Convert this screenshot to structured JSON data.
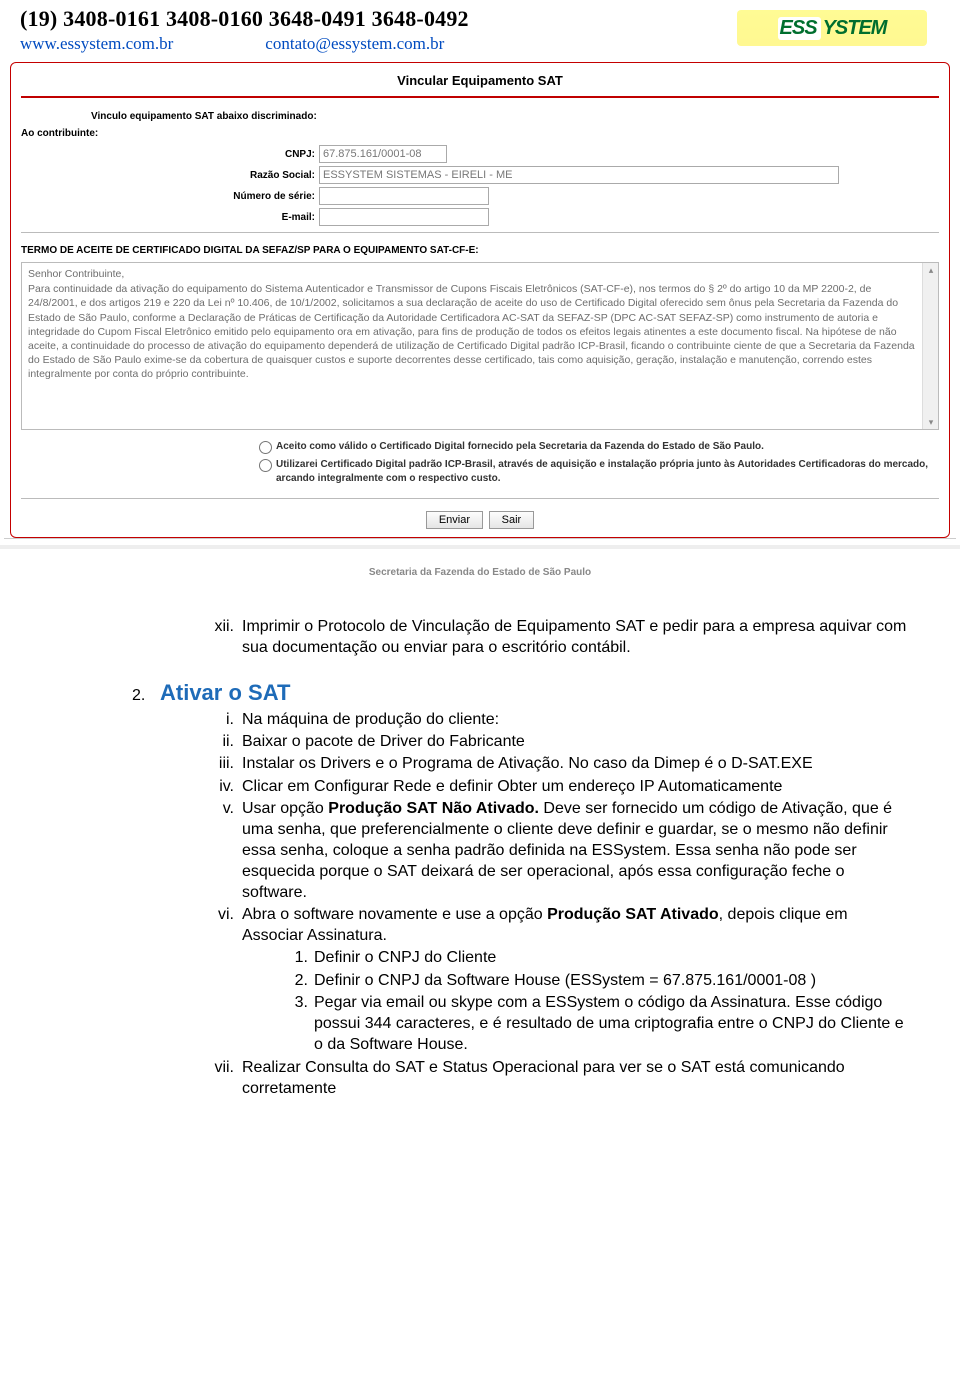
{
  "header": {
    "phones": "(19) 3408-0161   3408-0160     3648-0491     3648-0492",
    "website": "www.essystem.com.br",
    "email": "contato@essystem.com.br",
    "logo_text_1": "ESS",
    "logo_text_2": "YSTEM"
  },
  "form": {
    "title": "Vincular Equipamento SAT",
    "sub1": "Vinculo equipamento SAT abaixo discriminado:",
    "sub2": "Ao contribuinte:",
    "cnpj_label": "CNPJ:",
    "cnpj_value": "67.875.161/0001-08",
    "razao_label": "Razão Social:",
    "razao_value": "ESSYSTEM SISTEMAS - EIRELI - ME",
    "serie_label": "Número de série:",
    "serie_value": "",
    "email_label": "E-mail:",
    "email_value": "",
    "term_head": "TERMO DE ACEITE DE CERTIFICADO DIGITAL DA SEFAZ/SP PARA O EQUIPAMENTO SAT-CF-E:",
    "term_body_sal": "Senhor Contribuinte,",
    "term_body": "Para continuidade da ativação do equipamento do Sistema Autenticador e Transmissor de Cupons Fiscais Eletrônicos (SAT-CF-e), nos termos do § 2º do artigo 10 da MP 2200-2, de 24/8/2001, e dos artigos 219 e 220 da Lei nº 10.406, de 10/1/2002, solicitamos a sua declaração de aceite do uso de Certificado Digital oferecido sem ônus pela Secretaria da Fazenda do Estado de São Paulo, conforme a Declaração de Práticas de Certificação da Autoridade Certificadora AC-SAT da SEFAZ-SP (DPC AC-SAT SEFAZ-SP) como instrumento de autoria e integridade do Cupom Fiscal Eletrônico emitido pelo equipamento ora em ativação, para fins de produção de todos os efeitos legais atinentes a este documento fiscal. Na hipótese de não aceite, a continuidade do processo de ativação do equipamento dependerá de utilização de Certificado Digital padrão ICP-Brasil, ficando o contribuinte ciente de que a Secretaria da Fazenda do Estado de São Paulo exime-se da cobertura de quaisquer custos e suporte decorrentes desse certificado, tais como aquisição, geração, instalação e manutenção, correndo estes integralmente por conta do próprio contribuinte.",
    "radio1": "Aceito como válido o Certificado Digital fornecido pela Secretaria da Fazenda do Estado de São Paulo.",
    "radio2": "Utilizarei Certificado Digital padrão ICP-Brasil, através de aquisição e instalação própria junto às Autoridades Certificadoras do mercado, arcando integralmente com o respectivo custo.",
    "btn_enviar": "Enviar",
    "btn_sair": "Sair",
    "footer": "Secretaria da Fazenda do Estado de São Paulo"
  },
  "doc": {
    "prev_marker": "xii.",
    "prev_body": "Imprimir o Protocolo de Vinculação de Equipamento SAT e pedir para a empresa aquivar com sua documentação ou enviar para o escritório contábil.",
    "h2_num": "2.",
    "h2_title": "Ativar o SAT",
    "i_m": "i.",
    "i_b": "Na máquina de produção do cliente:",
    "ii_m": "ii.",
    "ii_b": "Baixar o pacote de Driver do Fabricante",
    "iii_m": "iii.",
    "iii_b": "Instalar os Drivers e o Programa de Ativação. No caso da Dimep é o D-SAT.EXE",
    "iv_m": "iv.",
    "iv_b": "Clicar em Configurar Rede e definir Obter um endereço IP Automaticamente",
    "v_m": "v.",
    "v_pre": "Usar opção ",
    "v_bold": "Produção SAT Não Ativado.",
    "v_post": " Deve ser fornecido um código de Ativação, que é uma senha, que preferencialmente o cliente deve definir e guardar, se o mesmo não definir essa senha, coloque a senha padrão definida na ESSystem. Essa senha não pode ser esquecida porque o SAT deixará de ser operacional, após essa configuração feche o software.",
    "vi_m": "vi.",
    "vi_pre": "Abra o software novamente e use a opção ",
    "vi_bold": "Produção SAT Ativado",
    "vi_post": ", depois clique em Associar Assinatura.",
    "n1_m": "1.",
    "n1_b": "Definir o CNPJ do Cliente",
    "n2_m": "2.",
    "n2_b": "Definir o CNPJ da Software House (ESSystem = 67.875.161/0001-08 )",
    "n3_m": "3.",
    "n3_b": "Pegar via email ou skype com a ESSystem o código da Assinatura. Esse código possui 344 caracteres, e é resultado de uma criptografia entre o CNPJ do Cliente e o da Software House.",
    "vii_m": "vii.",
    "vii_b": "Realizar Consulta do SAT e Status Operacional para ver se o SAT está comunicando corretamente"
  }
}
